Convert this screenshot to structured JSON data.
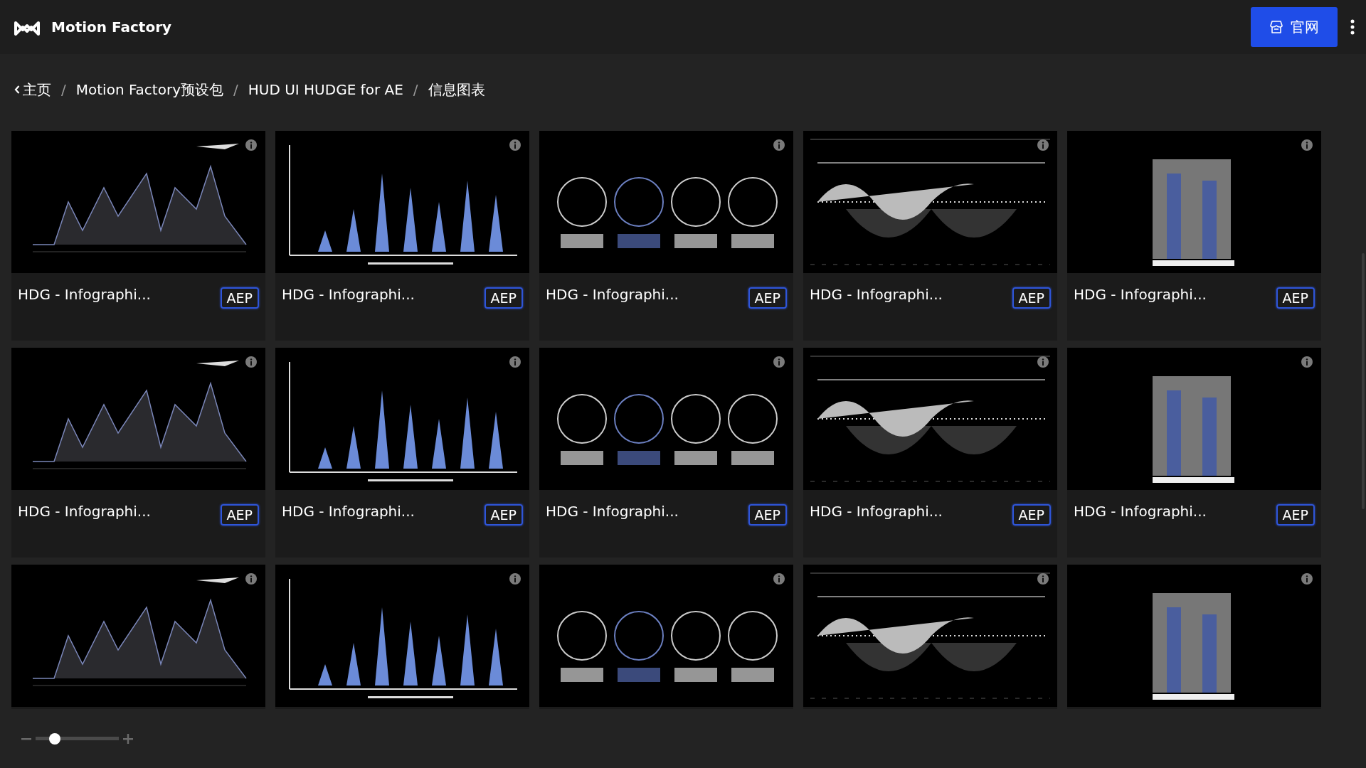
{
  "header": {
    "brand": "Motion Factory",
    "site_button": "官网"
  },
  "breadcrumb": [
    {
      "kind": "back",
      "text": "主页"
    },
    {
      "kind": "separator",
      "text": "/"
    },
    {
      "kind": "link",
      "text": "Motion Factory预设包"
    },
    {
      "kind": "separator",
      "text": "/"
    },
    {
      "kind": "link",
      "text": "HUD UI HUDGE for AE"
    },
    {
      "kind": "separator",
      "text": "/"
    },
    {
      "kind": "current",
      "text": "信息图表"
    }
  ],
  "cards": [
    {
      "title": "HDG - Infographi...",
      "badge": "AEP",
      "thumbnail": {
        "kind": "picture"
      }
    },
    {
      "title": "HDG - Infographi...",
      "badge": "AEP",
      "thumbnail": {
        "kind": "picture"
      }
    },
    {
      "title": "HDG - Infographi...",
      "badge": "AEP",
      "thumbnail": {
        "kind": "picture"
      }
    },
    {
      "title": "HDG - Infographi...",
      "badge": "AEP",
      "thumbnail": {
        "kind": "picture"
      }
    },
    {
      "title": "HDG - Infographi...",
      "badge": "AEP",
      "thumbnail": {
        "kind": "picture"
      }
    },
    {
      "title": "HDG - Infographi...",
      "badge": "AEP",
      "thumbnail": {
        "kind": "picture"
      }
    },
    {
      "title": "HDG - Infographi...",
      "badge": "AEP",
      "thumbnail": {
        "kind": "picture"
      }
    },
    {
      "title": "HDG - Infographi...",
      "badge": "AEP",
      "thumbnail": {
        "kind": "picture"
      }
    },
    {
      "title": "HDG - Infographi...",
      "badge": "AEP",
      "thumbnail": {
        "kind": "picture"
      }
    },
    {
      "title": "HDG - Infographi...",
      "badge": "AEP",
      "thumbnail": {
        "kind": "picture"
      }
    },
    {
      "thumbnail": {
        "kind": "picture"
      }
    },
    {
      "thumbnail": {
        "kind": "picture"
      }
    },
    {
      "thumbnail": {
        "kind": "picture"
      }
    },
    {
      "thumbnail": {
        "kind": "picture"
      }
    },
    {
      "thumbnail": {
        "kind": "picture"
      }
    }
  ],
  "zoom": {
    "level": 0.23
  }
}
